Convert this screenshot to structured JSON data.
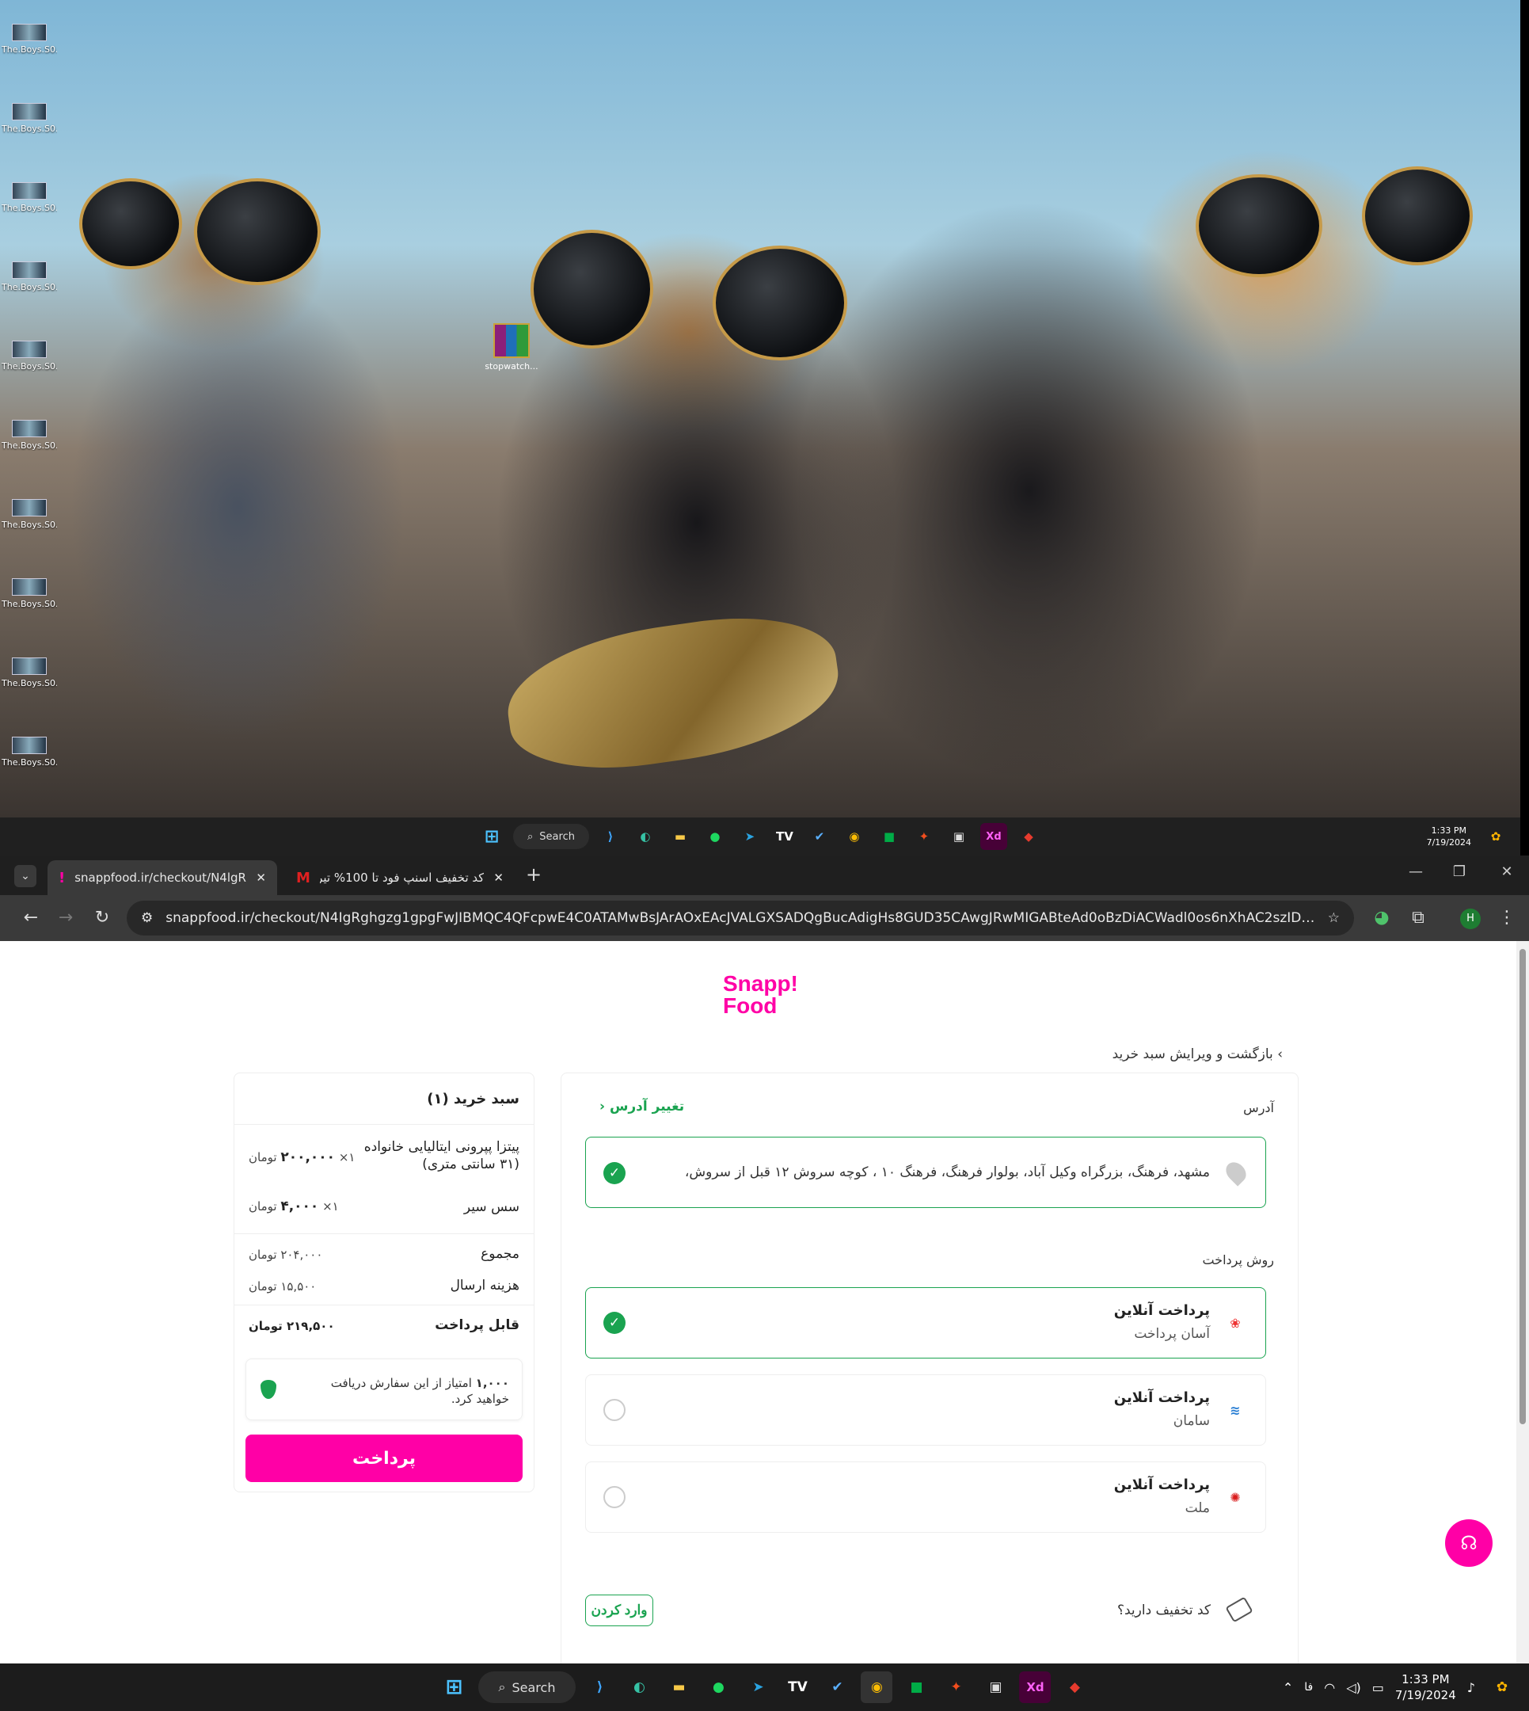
{
  "desktop": {
    "icons": [
      "The.Boys.S0...",
      "The.Boys.S0...",
      "The.Boys.S0...",
      "The.Boys.S0...",
      "The.Boys.S0...",
      "The.Boys.S0...",
      "The.Boys.S0...",
      "The.Boys.S0...",
      "The.Boys.S0...",
      "The.Boys.S0..."
    ],
    "stopwatch_label": "stopwatch..."
  },
  "taskbar": {
    "search_label": "Search",
    "time": "1:33 PM",
    "date": "7/19/2024",
    "lang": "فا"
  },
  "browser": {
    "tabs": [
      {
        "title": "snappfood.ir/checkout/N4lgRg"
      },
      {
        "title": "کد تخفیف اسنپ فود تا 100% تیر"
      }
    ],
    "url": "snappfood.ir/checkout/N4IgRghgzg1gpgFwJIBMQC4QFcpwE4C0ATAMwBsJArAOxEAcJVALGXSADQgBucAdigHs8GUD35CAwgJRwMIGABteAd0oBzDiACWadl0os6nXhAC2szID8wQDNggKjB..."
  },
  "page": {
    "logo_line1": "Snapp!",
    "logo_line2": "Food",
    "back_link": "بازگشت و ویرایش سبد خرید",
    "address_label": "آدرس",
    "change_address": "تغییر آدرس",
    "address_text": "مشهد، فرهنگ، بزرگراه وکیل آباد، بولوار فرهنگ، فرهنگ ۱۰ ، کوچه سروش ۱۲ قبل از سروش،",
    "payment_label": "روش پرداخت",
    "payment_options": [
      {
        "title": "پرداخت آنلاین",
        "bank": "آسان پرداخت",
        "selected": true
      },
      {
        "title": "پرداخت آنلاین",
        "bank": "سامان",
        "selected": false
      },
      {
        "title": "پرداخت آنلاین",
        "bank": "ملت",
        "selected": false
      }
    ],
    "discount_question": "کد تخفیف دارید؟",
    "discount_button": "وارد کردن"
  },
  "cart": {
    "title": "سبد خرید (۱)",
    "items": [
      {
        "name": "پیتزا پپرونی ایتالیایی خانواده (۳۱ سانتی متری)",
        "qty": "۱×",
        "price": "۲۰۰,۰۰۰",
        "unit": "تومان"
      },
      {
        "name": "سس سیر",
        "qty": "۱×",
        "price": "۴,۰۰۰",
        "unit": "تومان"
      }
    ],
    "subtotal_label": "مجموع",
    "subtotal_value": "۲۰۴,۰۰۰ تومان",
    "delivery_label": "هزینه ارسال",
    "delivery_value": "۱۵,۵۰۰ تومان",
    "total_label": "قابل پرداخت",
    "total_value": "۲۱۹,۵۰۰ تومان",
    "points_value": "۱,۰۰۰",
    "points_text": "امتیاز از این سفارش دریافت خواهید کرد.",
    "pay_button": "پرداخت"
  },
  "colors": {
    "brand": "#ff00a6",
    "success": "#1aa350"
  }
}
